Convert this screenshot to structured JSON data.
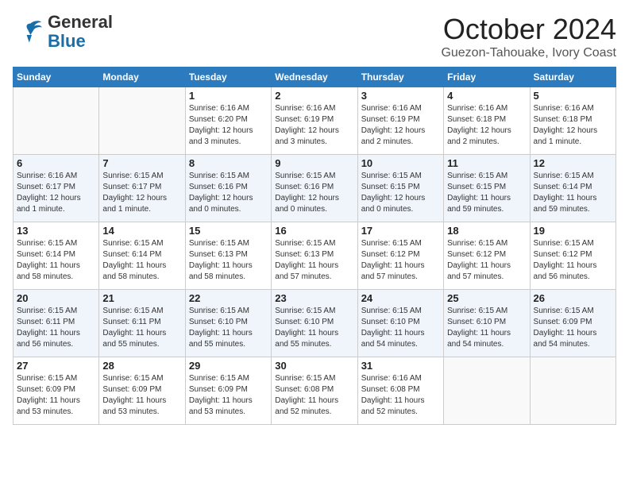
{
  "header": {
    "logo_line1": "General",
    "logo_line2": "Blue",
    "title": "October 2024",
    "location": "Guezon-Tahouake, Ivory Coast"
  },
  "weekdays": [
    "Sunday",
    "Monday",
    "Tuesday",
    "Wednesday",
    "Thursday",
    "Friday",
    "Saturday"
  ],
  "weeks": [
    [
      {
        "day": "",
        "info": ""
      },
      {
        "day": "",
        "info": ""
      },
      {
        "day": "1",
        "info": "Sunrise: 6:16 AM\nSunset: 6:20 PM\nDaylight: 12 hours\nand 3 minutes."
      },
      {
        "day": "2",
        "info": "Sunrise: 6:16 AM\nSunset: 6:19 PM\nDaylight: 12 hours\nand 3 minutes."
      },
      {
        "day": "3",
        "info": "Sunrise: 6:16 AM\nSunset: 6:19 PM\nDaylight: 12 hours\nand 2 minutes."
      },
      {
        "day": "4",
        "info": "Sunrise: 6:16 AM\nSunset: 6:18 PM\nDaylight: 12 hours\nand 2 minutes."
      },
      {
        "day": "5",
        "info": "Sunrise: 6:16 AM\nSunset: 6:18 PM\nDaylight: 12 hours\nand 1 minute."
      }
    ],
    [
      {
        "day": "6",
        "info": "Sunrise: 6:16 AM\nSunset: 6:17 PM\nDaylight: 12 hours\nand 1 minute."
      },
      {
        "day": "7",
        "info": "Sunrise: 6:15 AM\nSunset: 6:17 PM\nDaylight: 12 hours\nand 1 minute."
      },
      {
        "day": "8",
        "info": "Sunrise: 6:15 AM\nSunset: 6:16 PM\nDaylight: 12 hours\nand 0 minutes."
      },
      {
        "day": "9",
        "info": "Sunrise: 6:15 AM\nSunset: 6:16 PM\nDaylight: 12 hours\nand 0 minutes."
      },
      {
        "day": "10",
        "info": "Sunrise: 6:15 AM\nSunset: 6:15 PM\nDaylight: 12 hours\nand 0 minutes."
      },
      {
        "day": "11",
        "info": "Sunrise: 6:15 AM\nSunset: 6:15 PM\nDaylight: 11 hours\nand 59 minutes."
      },
      {
        "day": "12",
        "info": "Sunrise: 6:15 AM\nSunset: 6:14 PM\nDaylight: 11 hours\nand 59 minutes."
      }
    ],
    [
      {
        "day": "13",
        "info": "Sunrise: 6:15 AM\nSunset: 6:14 PM\nDaylight: 11 hours\nand 58 minutes."
      },
      {
        "day": "14",
        "info": "Sunrise: 6:15 AM\nSunset: 6:14 PM\nDaylight: 11 hours\nand 58 minutes."
      },
      {
        "day": "15",
        "info": "Sunrise: 6:15 AM\nSunset: 6:13 PM\nDaylight: 11 hours\nand 58 minutes."
      },
      {
        "day": "16",
        "info": "Sunrise: 6:15 AM\nSunset: 6:13 PM\nDaylight: 11 hours\nand 57 minutes."
      },
      {
        "day": "17",
        "info": "Sunrise: 6:15 AM\nSunset: 6:12 PM\nDaylight: 11 hours\nand 57 minutes."
      },
      {
        "day": "18",
        "info": "Sunrise: 6:15 AM\nSunset: 6:12 PM\nDaylight: 11 hours\nand 57 minutes."
      },
      {
        "day": "19",
        "info": "Sunrise: 6:15 AM\nSunset: 6:12 PM\nDaylight: 11 hours\nand 56 minutes."
      }
    ],
    [
      {
        "day": "20",
        "info": "Sunrise: 6:15 AM\nSunset: 6:11 PM\nDaylight: 11 hours\nand 56 minutes."
      },
      {
        "day": "21",
        "info": "Sunrise: 6:15 AM\nSunset: 6:11 PM\nDaylight: 11 hours\nand 55 minutes."
      },
      {
        "day": "22",
        "info": "Sunrise: 6:15 AM\nSunset: 6:10 PM\nDaylight: 11 hours\nand 55 minutes."
      },
      {
        "day": "23",
        "info": "Sunrise: 6:15 AM\nSunset: 6:10 PM\nDaylight: 11 hours\nand 55 minutes."
      },
      {
        "day": "24",
        "info": "Sunrise: 6:15 AM\nSunset: 6:10 PM\nDaylight: 11 hours\nand 54 minutes."
      },
      {
        "day": "25",
        "info": "Sunrise: 6:15 AM\nSunset: 6:10 PM\nDaylight: 11 hours\nand 54 minutes."
      },
      {
        "day": "26",
        "info": "Sunrise: 6:15 AM\nSunset: 6:09 PM\nDaylight: 11 hours\nand 54 minutes."
      }
    ],
    [
      {
        "day": "27",
        "info": "Sunrise: 6:15 AM\nSunset: 6:09 PM\nDaylight: 11 hours\nand 53 minutes."
      },
      {
        "day": "28",
        "info": "Sunrise: 6:15 AM\nSunset: 6:09 PM\nDaylight: 11 hours\nand 53 minutes."
      },
      {
        "day": "29",
        "info": "Sunrise: 6:15 AM\nSunset: 6:09 PM\nDaylight: 11 hours\nand 53 minutes."
      },
      {
        "day": "30",
        "info": "Sunrise: 6:15 AM\nSunset: 6:08 PM\nDaylight: 11 hours\nand 52 minutes."
      },
      {
        "day": "31",
        "info": "Sunrise: 6:16 AM\nSunset: 6:08 PM\nDaylight: 11 hours\nand 52 minutes."
      },
      {
        "day": "",
        "info": ""
      },
      {
        "day": "",
        "info": ""
      }
    ]
  ]
}
